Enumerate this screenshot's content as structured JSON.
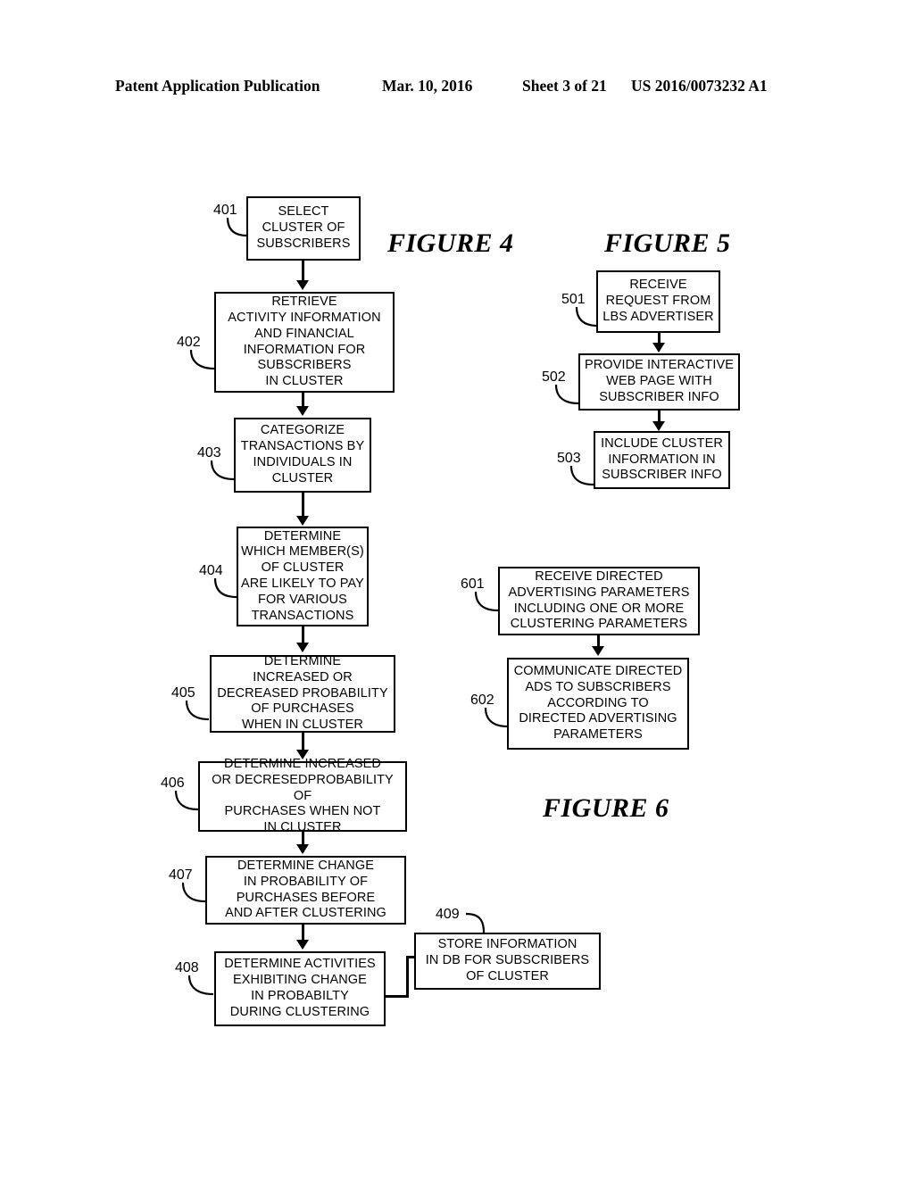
{
  "header": {
    "publication": "Patent Application Publication",
    "date": "Mar. 10, 2016",
    "sheet": "Sheet 3 of 21",
    "patent_number": "US 2016/0073232 A1"
  },
  "figures": {
    "fig4_title": "FIGURE 4",
    "fig5_title": "FIGURE 5",
    "fig6_title": "FIGURE 6"
  },
  "figure4": {
    "steps": [
      {
        "ref": "401",
        "text": "SELECT\nCLUSTER OF\nSUBSCRIBERS"
      },
      {
        "ref": "402",
        "text": "RETRIEVE\nACTIVITY INFORMATION\nAND FINANCIAL\nINFORMATION FOR\nSUBSCRIBERS\nIN CLUSTER"
      },
      {
        "ref": "403",
        "text": "CATEGORIZE\nTRANSACTIONS BY\nINDIVIDUALS IN\nCLUSTER"
      },
      {
        "ref": "404",
        "text": "DETERMINE\nWHICH MEMBER(S)\nOF CLUSTER\nARE LIKELY TO PAY\nFOR VARIOUS\nTRANSACTIONS"
      },
      {
        "ref": "405",
        "text": "DETERMINE\nINCREASED OR\nDECREASED PROBABILITY\nOF PURCHASES\nWHEN IN CLUSTER"
      },
      {
        "ref": "406",
        "text": "DETERMINE INCREASED\nOR DECRESEDPROBABILITY OF\nPURCHASES WHEN NOT\nIN CLUSTER"
      },
      {
        "ref": "407",
        "text": "DETERMINE CHANGE\nIN PROBABILITY OF\nPURCHASES BEFORE\nAND AFTER CLUSTERING"
      },
      {
        "ref": "408",
        "text": "DETERMINE ACTIVITIES\nEXHIBITING CHANGE\nIN PROBABILTY\nDURING CLUSTERING"
      },
      {
        "ref": "409",
        "text": "STORE INFORMATION\nIN DB FOR SUBSCRIBERS\nOF CLUSTER"
      }
    ]
  },
  "figure5": {
    "steps": [
      {
        "ref": "501",
        "text": "RECEIVE\nREQUEST FROM\nLBS ADVERTISER"
      },
      {
        "ref": "502",
        "text": "PROVIDE INTERACTIVE\nWEB PAGE WITH\nSUBSCRIBER INFO"
      },
      {
        "ref": "503",
        "text": "INCLUDE CLUSTER\nINFORMATION IN\nSUBSCRIBER INFO"
      }
    ]
  },
  "figure6": {
    "steps": [
      {
        "ref": "601",
        "text": "RECEIVE DIRECTED\nADVERTISING PARAMETERS\nINCLUDING ONE OR MORE\nCLUSTERING PARAMETERS"
      },
      {
        "ref": "602",
        "text": "COMMUNICATE DIRECTED\nADS TO SUBSCRIBERS\nACCORDING TO\nDIRECTED ADVERTISING\nPARAMETERS"
      }
    ]
  },
  "colors": {
    "ink": "#000000",
    "paper": "#ffffff"
  }
}
